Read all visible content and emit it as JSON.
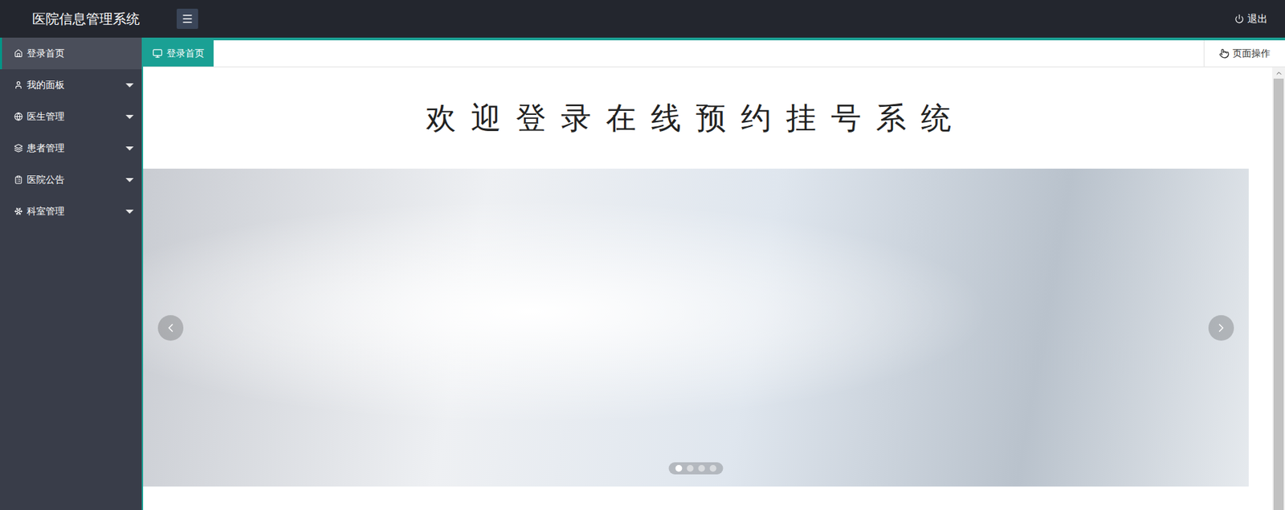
{
  "header": {
    "title": "医院信息管理系统",
    "logout": "退出"
  },
  "sidebar": {
    "items": [
      {
        "label": "登录首页",
        "selected": true,
        "expandable": false
      },
      {
        "label": "我的面板",
        "selected": false,
        "expandable": true
      },
      {
        "label": "医生管理",
        "selected": false,
        "expandable": true
      },
      {
        "label": "患者管理",
        "selected": false,
        "expandable": true
      },
      {
        "label": "医院公告",
        "selected": false,
        "expandable": true
      },
      {
        "label": "科室管理",
        "selected": false,
        "expandable": true
      }
    ]
  },
  "tabs": [
    {
      "label": "登录首页",
      "selected": true
    }
  ],
  "page_actions": {
    "label": "页面操作"
  },
  "welcome": {
    "title": "欢迎登录在线预约挂号系统"
  },
  "carousel": {
    "dots": [
      {
        "selected": true
      },
      {
        "selected": false
      },
      {
        "selected": false
      },
      {
        "selected": false
      }
    ]
  }
}
